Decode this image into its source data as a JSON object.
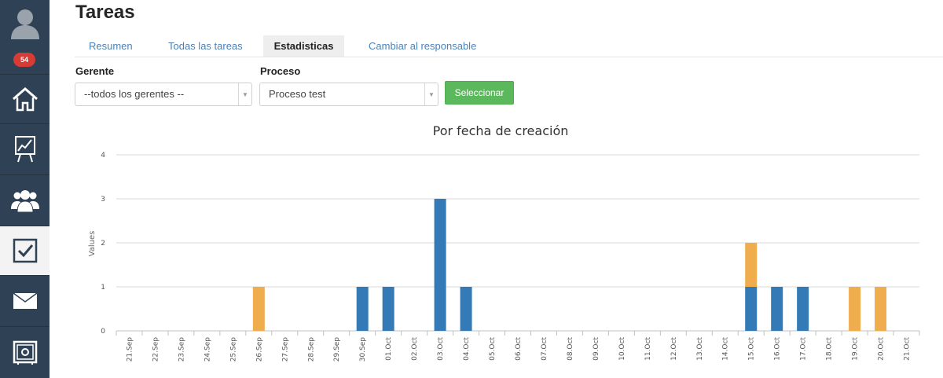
{
  "page": {
    "title": "Tareas"
  },
  "sidebar": {
    "badge": "54",
    "items": [
      {
        "name": "avatar",
        "icon": "user-avatar-icon"
      },
      {
        "name": "home",
        "icon": "home-icon"
      },
      {
        "name": "stats",
        "icon": "presentation-chart-icon"
      },
      {
        "name": "users",
        "icon": "users-group-icon"
      },
      {
        "name": "tasks",
        "icon": "checkbox-icon",
        "active": true
      },
      {
        "name": "mail",
        "icon": "envelope-icon"
      },
      {
        "name": "safe",
        "icon": "safe-icon"
      }
    ]
  },
  "tabs": [
    {
      "label": "Resumen"
    },
    {
      "label": "Todas las tareas"
    },
    {
      "label": "Estadisticas",
      "active": true
    },
    {
      "label": "Cambiar al responsable"
    }
  ],
  "filters": {
    "manager_label": "Gerente",
    "manager_value": "--todos los gerentes --",
    "process_label": "Proceso",
    "process_value": "Proceso test",
    "submit_label": "Seleccionar"
  },
  "chart_data": {
    "type": "bar",
    "stacked": true,
    "title": "Por fecha de creación",
    "ylabel": "Values",
    "ylim": [
      0,
      4
    ],
    "yticks": [
      0,
      1,
      2,
      3,
      4
    ],
    "grid": true,
    "categories": [
      "21.Sep",
      "22.Sep",
      "23.Sep",
      "24.Sep",
      "25.Sep",
      "26.Sep",
      "27.Sep",
      "28.Sep",
      "29.Sep",
      "30.Sep",
      "01.Oct",
      "02.Oct",
      "03.Oct",
      "04.Oct",
      "05.Oct",
      "06.Oct",
      "07.Oct",
      "08.Oct",
      "09.Oct",
      "10.Oct",
      "11.Oct",
      "12.Oct",
      "13.Oct",
      "14.Oct",
      "15.Oct",
      "16.Oct",
      "17.Oct",
      "18.Oct",
      "19.Oct",
      "20.Oct",
      "21.Oct"
    ],
    "series": [
      {
        "color": "#337ab7",
        "values": [
          0,
          0,
          0,
          0,
          0,
          0,
          0,
          0,
          0,
          1,
          1,
          0,
          3,
          1,
          0,
          0,
          0,
          0,
          0,
          0,
          0,
          0,
          0,
          0,
          1,
          1,
          1,
          0,
          0,
          0,
          0
        ]
      },
      {
        "color": "#f0ad4e",
        "values": [
          0,
          0,
          0,
          0,
          0,
          1,
          0,
          0,
          0,
          0,
          0,
          0,
          0,
          0,
          0,
          0,
          0,
          0,
          0,
          0,
          0,
          0,
          0,
          0,
          1,
          0,
          0,
          0,
          1,
          1,
          0
        ]
      }
    ]
  }
}
